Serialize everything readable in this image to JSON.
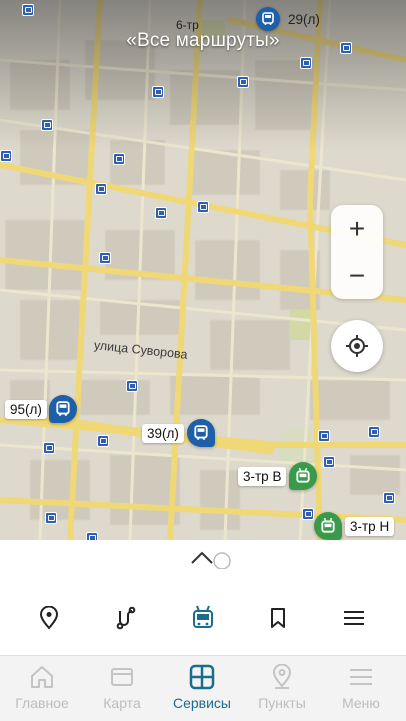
{
  "screen": {
    "title": "«Все маршруты»"
  },
  "map": {
    "street_label": "улица Суворова",
    "vehicles": [
      {
        "id": "v1",
        "label": "29(л)",
        "type": "bus",
        "color": "#1d5fa8"
      },
      {
        "id": "v2",
        "label": "6-тр",
        "type": "trolleybus",
        "color": "#3a9a4a"
      },
      {
        "id": "v3",
        "label": "95(л)",
        "type": "bus",
        "color": "#1d5fa8"
      },
      {
        "id": "v4",
        "label": "39(л)",
        "type": "bus",
        "color": "#1d5fa8"
      },
      {
        "id": "v5",
        "label": "3-тр В",
        "type": "trolleybus",
        "color": "#3a9a4a"
      },
      {
        "id": "v6",
        "label": "3-тр Н",
        "type": "trolleybus",
        "color": "#3a9a4a"
      }
    ],
    "controls": {
      "zoom_in": "+",
      "zoom_out": "−"
    }
  },
  "sheet": {
    "tools": [
      "location-pin-icon",
      "route-icon",
      "trolleybus-icon",
      "bookmark-icon",
      "menu-icon"
    ],
    "active_tool": 2
  },
  "tabbar": {
    "tabs": [
      {
        "label": "Главное",
        "icon": "home-icon"
      },
      {
        "label": "Карта",
        "icon": "map-card-icon"
      },
      {
        "label": "Сервисы",
        "icon": "services-grid-icon"
      },
      {
        "label": "Пункты",
        "icon": "location-pin-icon"
      },
      {
        "label": "Меню",
        "icon": "hamburger-icon"
      }
    ],
    "active": 2
  },
  "colors": {
    "accent": "#1b6d8c",
    "bus": "#1d5fa8",
    "trolleybus": "#3a9a4a",
    "road": "#f2dc7a"
  }
}
